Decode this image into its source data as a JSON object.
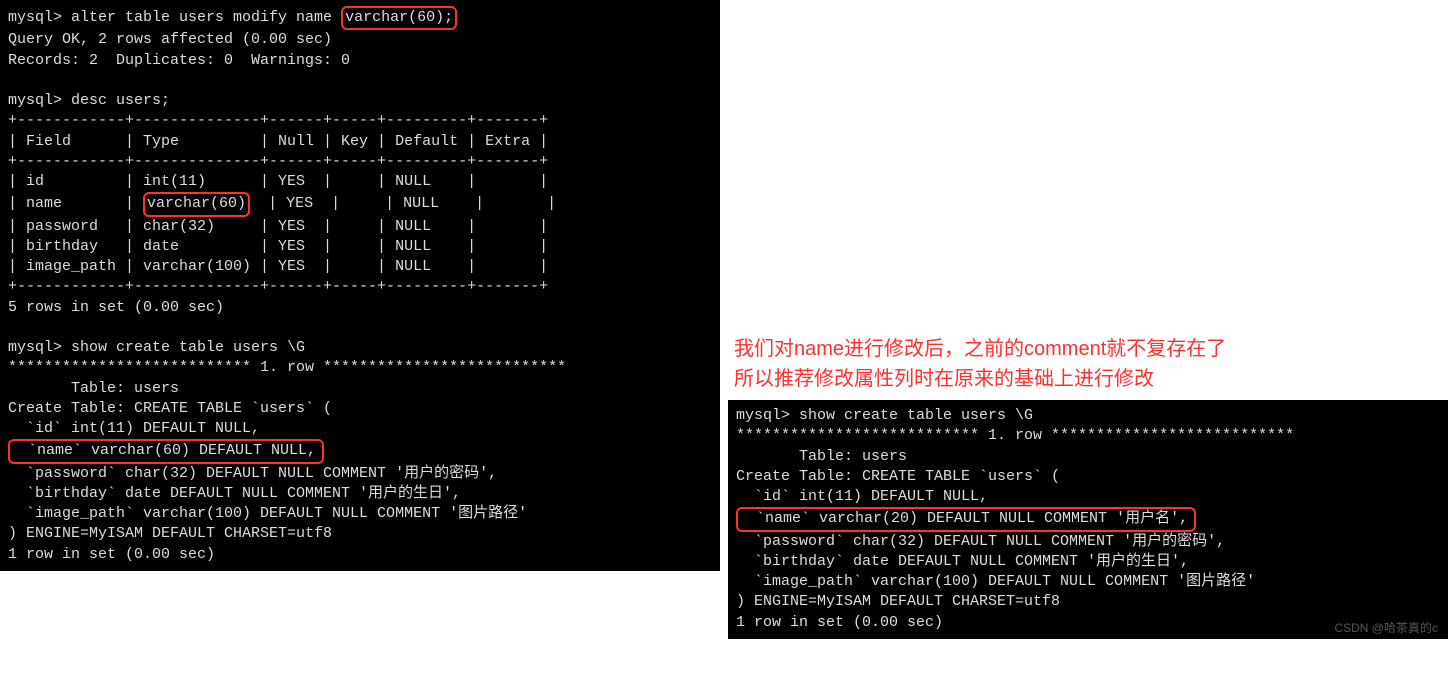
{
  "left": {
    "prompt": "mysql> ",
    "cmd_alter_pre": "alter table users modify name ",
    "cmd_alter_box": "varchar(60);",
    "result1": "Query OK, 2 rows affected (0.00 sec)",
    "result2": "Records: 2  Duplicates: 0  Warnings: 0",
    "cmd_desc": "desc users;",
    "table_sep": "+------------+--------------+------+-----+---------+-------+",
    "table_hdr": "| Field      | Type         | Null | Key | Default | Extra |",
    "row_id": "| id         | int(11)      | YES  |     | NULL    |       |",
    "row_name_a": "| name       | ",
    "row_name_box": "varchar(60)",
    "row_name_b": "  | YES  |     | NULL    |       |",
    "row_pw": "| password   | char(32)     | YES  |     | NULL    |       |",
    "row_bd": "| birthday   | date         | YES  |     | NULL    |       |",
    "row_img": "| image_path | varchar(100) | YES  |     | NULL    |       |",
    "rows_set": "5 rows in set (0.00 sec)",
    "cmd_show": "show create table users \\G",
    "stars_row": "*************************** 1. row ***************************",
    "tbl_line": "       Table: users",
    "ct_head": "Create Table: CREATE TABLE `users` (",
    "ct_id": "  `id` int(11) DEFAULT NULL,",
    "ct_name_box": "  `name` varchar(60) DEFAULT NULL,",
    "ct_pw": "  `password` char(32) DEFAULT NULL COMMENT '用户的密码',",
    "ct_bd": "  `birthday` date DEFAULT NULL COMMENT '用户的生日',",
    "ct_img": "  `image_path` varchar(100) DEFAULT NULL COMMENT '图片路径'",
    "ct_tail": ") ENGINE=MyISAM DEFAULT CHARSET=utf8",
    "row1": "1 row in set (0.00 sec)"
  },
  "annotation": {
    "line1": "我们对name进行修改后，之前的comment就不复存在了",
    "line2": "所以推荐修改属性列时在原来的基础上进行修改"
  },
  "right": {
    "prompt": "mysql> ",
    "cmd_show": "show create table users \\G",
    "stars_row": "*************************** 1. row ***************************",
    "tbl_line": "       Table: users",
    "ct_head": "Create Table: CREATE TABLE `users` (",
    "ct_id": "  `id` int(11) DEFAULT NULL,",
    "ct_name_box": "  `name` varchar(20) DEFAULT NULL COMMENT '用户名',",
    "ct_pw": "  `password` char(32) DEFAULT NULL COMMENT '用户的密码',",
    "ct_bd": "  `birthday` date DEFAULT NULL COMMENT '用户的生日',",
    "ct_img": "  `image_path` varchar(100) DEFAULT NULL COMMENT '图片路径'",
    "ct_tail": ") ENGINE=MyISAM DEFAULT CHARSET=utf8",
    "row1": "1 row in set (0.00 sec)"
  },
  "watermark": "CSDN @哈茶真的c"
}
